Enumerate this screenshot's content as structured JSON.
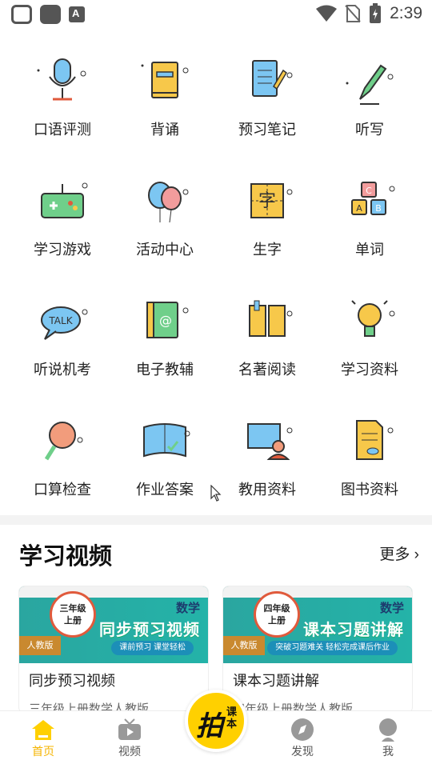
{
  "status_bar": {
    "time": "2:39"
  },
  "grid": {
    "items": [
      {
        "label": "口语评测",
        "icon": "microphone-icon"
      },
      {
        "label": "背诵",
        "icon": "book-icon"
      },
      {
        "label": "预习笔记",
        "icon": "notebook-pencil-icon"
      },
      {
        "label": "听写",
        "icon": "pen-icon"
      },
      {
        "label": "学习游戏",
        "icon": "gamepad-icon"
      },
      {
        "label": "活动中心",
        "icon": "balloons-icon"
      },
      {
        "label": "生字",
        "icon": "character-card-icon"
      },
      {
        "label": "单词",
        "icon": "abc-blocks-icon"
      },
      {
        "label": "听说机考",
        "icon": "talk-bubble-icon"
      },
      {
        "label": "电子教辅",
        "icon": "address-book-icon"
      },
      {
        "label": "名著阅读",
        "icon": "open-book-icon"
      },
      {
        "label": "学习资料",
        "icon": "lightbulb-icon"
      },
      {
        "label": "口算检查",
        "icon": "magnifier-icon"
      },
      {
        "label": "作业答案",
        "icon": "answer-book-icon"
      },
      {
        "label": "教用资料",
        "icon": "teacher-board-icon"
      },
      {
        "label": "图书资料",
        "icon": "document-icon"
      }
    ]
  },
  "videos": {
    "title": "学习视频",
    "more": "更多",
    "cards": [
      {
        "subject": "数学",
        "badge_line1": "三年级",
        "badge_line2": "上册",
        "heading": "同步预习视频",
        "edition": "人教版",
        "pill": "课前预习 课堂轻松",
        "title": "同步预习视频",
        "subtitle": "三年级上册数学人教版"
      },
      {
        "subject": "数学",
        "badge_line1": "四年级",
        "badge_line2": "上册",
        "heading": "课本习题讲解",
        "edition": "人教版",
        "pill": "突破习题难关 轻松完成课后作业",
        "title": "课本习题讲解",
        "subtitle": "四年级上册数学人教版"
      }
    ]
  },
  "tabbar": {
    "tabs": [
      {
        "label": "首页",
        "icon": "home-icon",
        "active": true
      },
      {
        "label": "视频",
        "icon": "tv-icon",
        "active": false
      },
      {
        "label": "发现",
        "icon": "compass-icon",
        "active": false
      },
      {
        "label": "我",
        "icon": "user-icon",
        "active": false
      }
    ],
    "center_main": "拍",
    "center_side": "课本"
  },
  "colors": {
    "accent": "#ffd000",
    "active_tab": "#f5b400",
    "teal": "#2aa6a0"
  }
}
